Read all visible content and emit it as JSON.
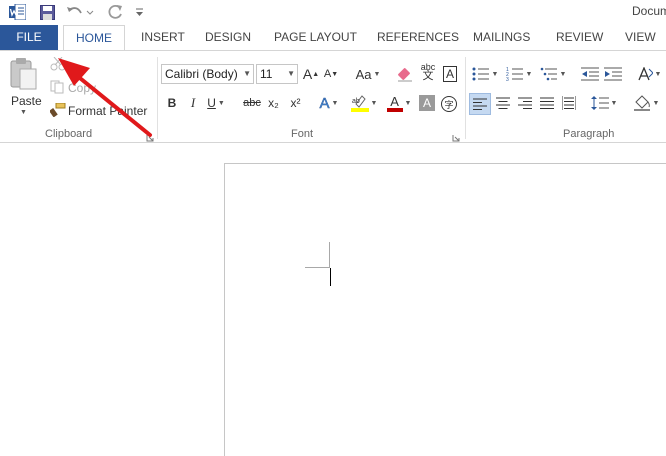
{
  "window": {
    "title": "Docum"
  },
  "tabs": {
    "file": "FILE",
    "home": "HOME",
    "insert": "INSERT",
    "design": "DESIGN",
    "page_layout": "PAGE LAYOUT",
    "references": "REFERENCES",
    "mailings": "MAILINGS",
    "review": "REVIEW",
    "view": "VIEW"
  },
  "clipboard": {
    "label": "Clipboard",
    "paste": "Paste",
    "copy": "Copy",
    "format_painter": "Format Painter"
  },
  "font": {
    "label": "Font",
    "name": "Calibri (Body)",
    "size": "11",
    "bold": "B",
    "italic": "I",
    "underline": "U",
    "strikethrough": "abc",
    "subscript": "x₂",
    "superscript": "x²",
    "grow": "A",
    "shrink": "A",
    "case": "Aa",
    "clear_format_letters": "abc",
    "char_border": "A",
    "font_color": "A",
    "char_shading": "A",
    "enclose": "字"
  },
  "paragraph": {
    "label": "Paragraph"
  },
  "colors": {
    "accent": "#2b579a",
    "highlight": "#ffff00",
    "font_color": "#c00000",
    "arrow": "#e0191b"
  }
}
